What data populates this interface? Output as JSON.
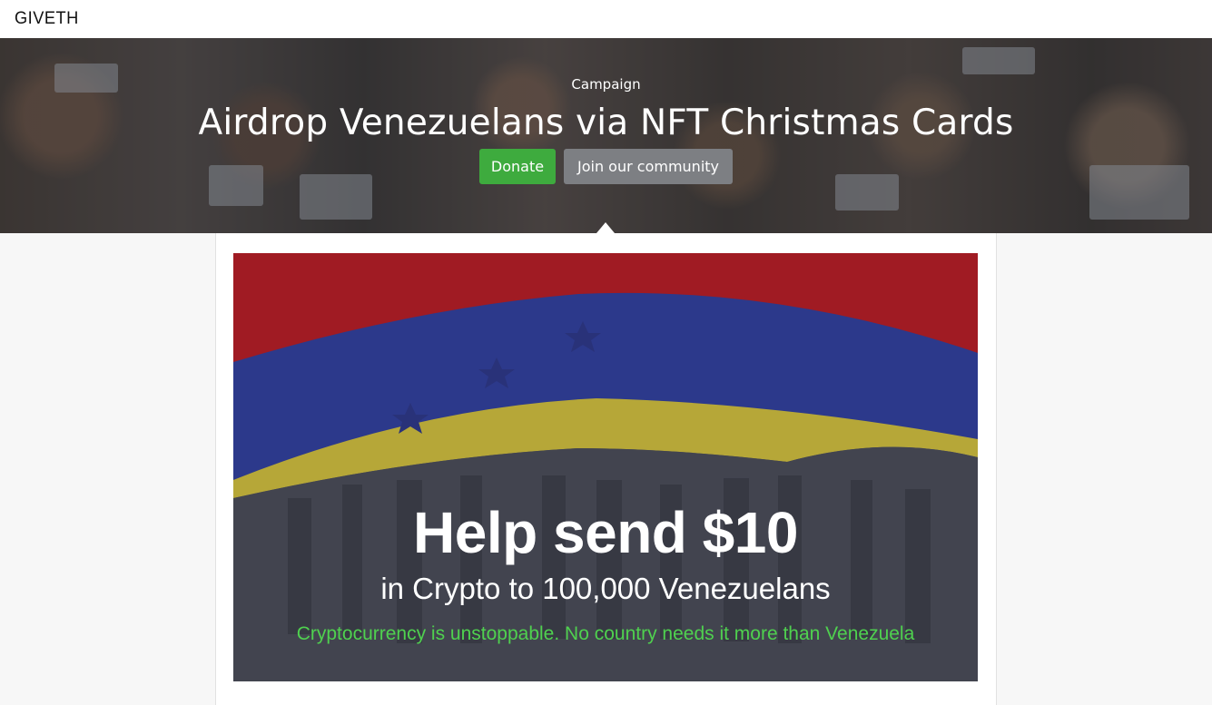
{
  "header": {
    "logo_text": "GIVETH"
  },
  "hero": {
    "kicker": "Campaign",
    "title": "Airdrop Venezuelans via NFT Christmas Cards",
    "donate_label": "Donate",
    "community_label": "Join our community",
    "donate_color": "#3eab3e",
    "community_color": "#7d7f83"
  },
  "banner": {
    "headline": "Help send $10",
    "subheadline": "in Crypto to 100,000 Venezuelans",
    "tagline": "Cryptocurrency is unstoppable. No country needs it more than Venezuela",
    "tagline_color": "#4fd14f",
    "flag_colors": [
      "#c8171e",
      "#2e3fa8",
      "#e6d23a"
    ]
  }
}
